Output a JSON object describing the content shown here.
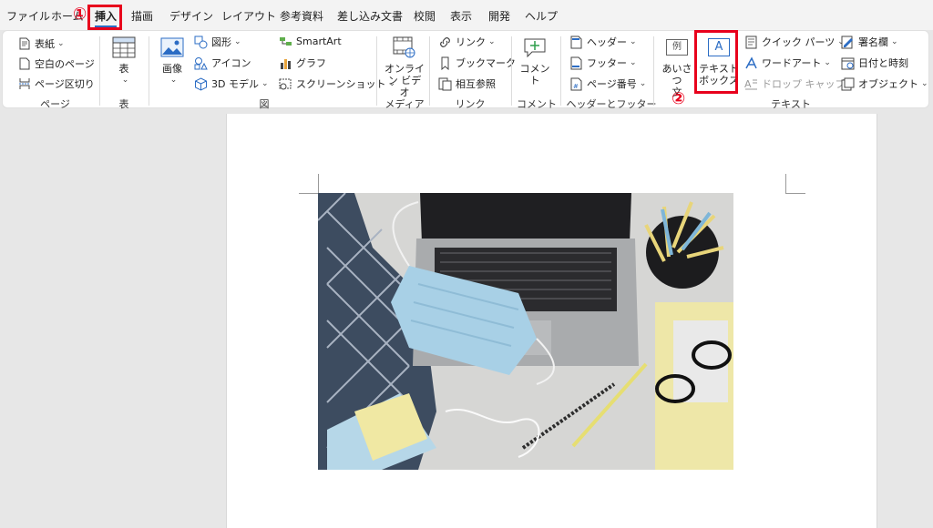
{
  "tabs": [
    "ファイル",
    "ホーム",
    "挿入",
    "描画",
    "デザイン",
    "レイアウト",
    "参考資料",
    "差し込み文書",
    "校閲",
    "表示",
    "開発",
    "ヘルプ"
  ],
  "ribbon": {
    "pages": {
      "cover": "表紙",
      "blank": "空白のページ",
      "break": "ページ区切り",
      "label": "ページ"
    },
    "table": {
      "button": "表",
      "label": "表"
    },
    "illustrations": {
      "picture": "画像",
      "shapes": "図形",
      "icons": "アイコン",
      "model3d": "3D モデル",
      "smartart": "SmartArt",
      "chart": "グラフ",
      "screenshot": "スクリーンショット",
      "label": "図"
    },
    "media": {
      "video_line1": "オンライ",
      "video_line2": "ン ビデオ",
      "label": "メディア"
    },
    "links": {
      "link": "リンク",
      "bookmark": "ブックマーク",
      "crossref": "相互参照",
      "label": "リンク"
    },
    "comments": {
      "comment": "コメント",
      "label": "コメント"
    },
    "header_footer": {
      "header": "ヘッダー",
      "footer": "フッター",
      "page_number": "ページ番号",
      "label": "ヘッダーとフッター"
    },
    "text": {
      "greeting_line1": "あいさつ",
      "greeting_line2": "文",
      "greeting_icon": "例",
      "textbox_line1": "テキスト",
      "textbox_line2": "ボックス",
      "textbox_icon": "A",
      "quickparts": "クイック パーツ",
      "wordart": "ワードアート",
      "dropcap": "ドロップ キャップ",
      "signature": "署名欄",
      "datetime": "日付と時刻",
      "object": "オブジェクト",
      "label": "テキスト"
    }
  },
  "annotations": {
    "step1": "①",
    "step2": "②"
  },
  "colors": {
    "accent": "#2b6cc4",
    "highlight": "#e8001c"
  }
}
